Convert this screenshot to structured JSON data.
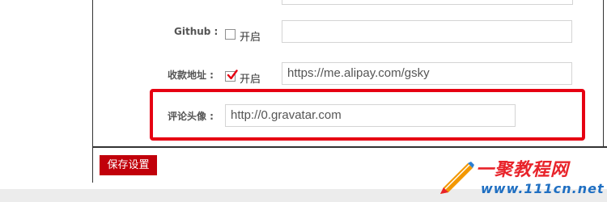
{
  "form": {
    "github": {
      "label": "Github :",
      "enable_label": "开启",
      "checked": false,
      "value": ""
    },
    "payment_address": {
      "label": "收款地址 :",
      "enable_label": "开启",
      "checked": true,
      "value": "https://me.alipay.com/gsky"
    },
    "comment_avatar": {
      "label": "评论头像 :",
      "value": "http://0.gravatar.com"
    }
  },
  "actions": {
    "save_label": "保存设置"
  },
  "watermark": {
    "brand": "一聚教程网",
    "domain": "www.111cn.net"
  },
  "colors": {
    "highlight": "#e60012",
    "save_button": "#c1000a",
    "watermark_red": "#e8232a",
    "watermark_blue": "#1f6fc2"
  }
}
